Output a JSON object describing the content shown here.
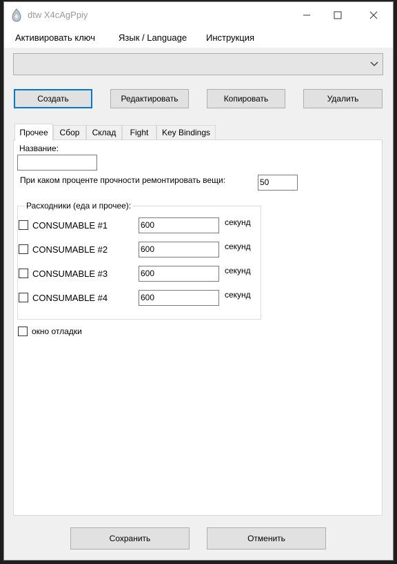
{
  "window": {
    "title": "dtw X4cAgPpiy"
  },
  "menu": [
    {
      "label": "Активировать ключ"
    },
    {
      "label": "Язык / Language"
    },
    {
      "label": "Инструкция"
    }
  ],
  "profile_select": {
    "value": ""
  },
  "actions": {
    "create": "Создать",
    "edit": "Редактировать",
    "copy": "Копировать",
    "delete": "Удалить"
  },
  "tabs": [
    {
      "label": "Прочее",
      "active": true
    },
    {
      "label": "Сбор"
    },
    {
      "label": "Склад"
    },
    {
      "label": "Fight"
    },
    {
      "label": "Key Bindings"
    }
  ],
  "form": {
    "name_label": "Название:",
    "name_value": "",
    "repair_label": "При каком проценте прочности ремонтировать вещи:",
    "repair_value": "50",
    "consumables_title": "Расходники (еда и прочее):",
    "consumables": [
      {
        "label": "CONSUMABLE #1",
        "checked": false,
        "value": "600",
        "unit": "секунд"
      },
      {
        "label": "CONSUMABLE #2",
        "checked": false,
        "value": "600",
        "unit": "секунд"
      },
      {
        "label": "CONSUMABLE #3",
        "checked": false,
        "value": "600",
        "unit": "секунд"
      },
      {
        "label": "CONSUMABLE #4",
        "checked": false,
        "value": "600",
        "unit": "секунд"
      }
    ],
    "debug_label": "окно отладки",
    "debug_checked": false
  },
  "footer": {
    "save": "Сохранить",
    "cancel": "Отменить"
  },
  "icons": {
    "app": "app-logo-icon",
    "minimize": "minimize-icon",
    "maximize": "maximize-icon",
    "close": "close-icon",
    "dropdown": "chevron-down-icon"
  },
  "colors": {
    "default_button_border": "#0078d7",
    "title_text": "#9a9a9a"
  }
}
